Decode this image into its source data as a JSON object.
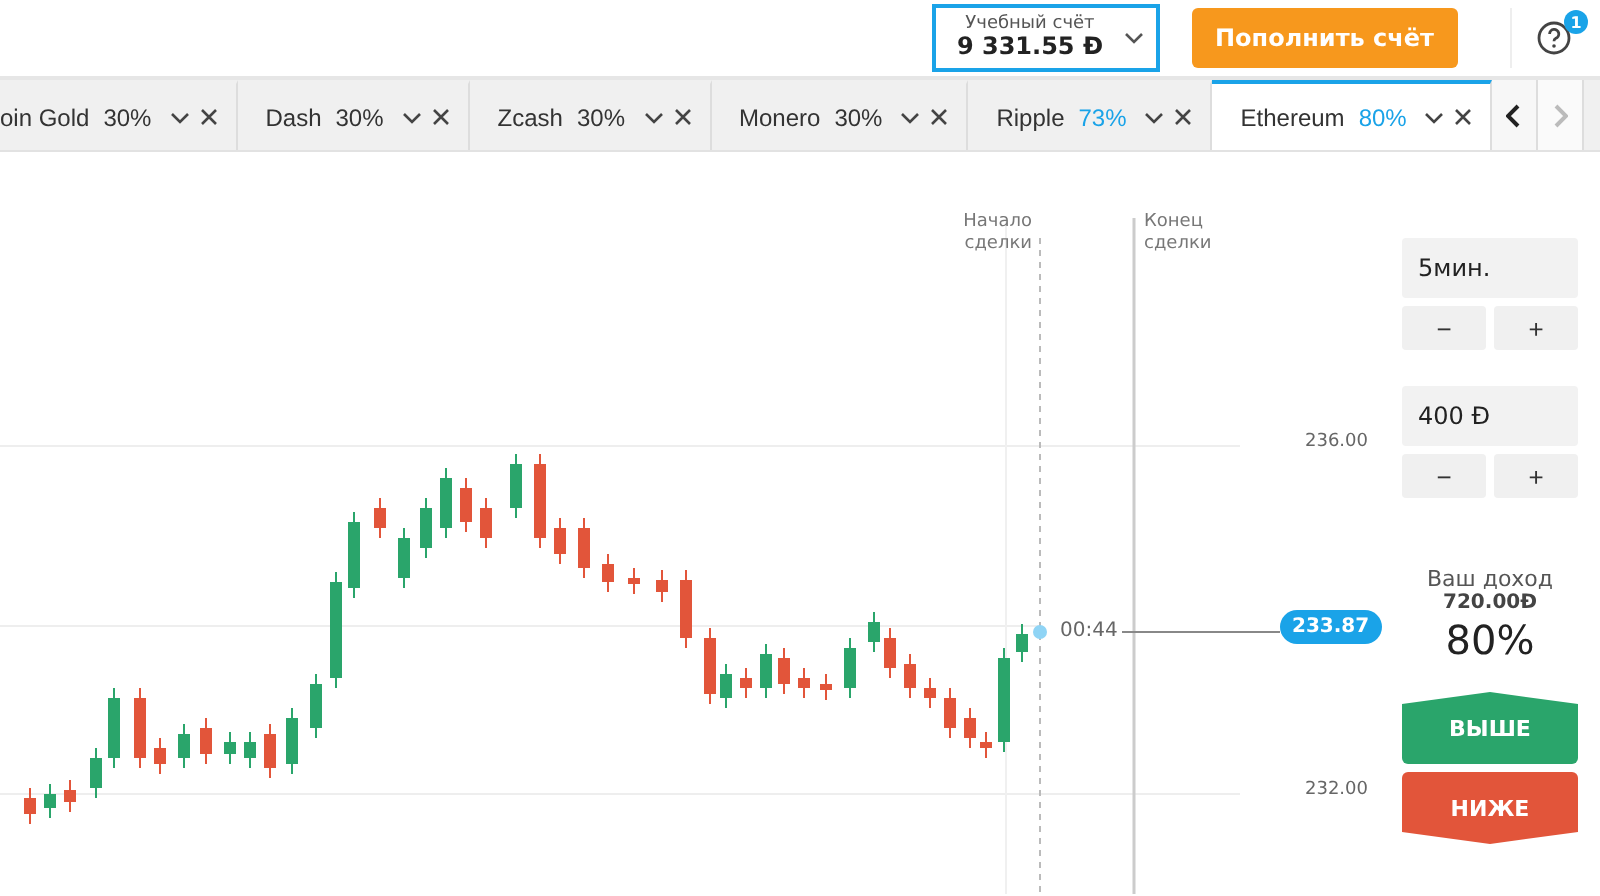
{
  "header": {
    "account": {
      "label": "Учебный счёт",
      "balance": "9 331.55 Ð"
    },
    "deposit_button": "Пополнить счёт",
    "help_badge": "1"
  },
  "tabs": [
    {
      "label": "oin Gold",
      "percent": "30%",
      "highlight": false,
      "selected": false
    },
    {
      "label": "Dash",
      "percent": "30%",
      "highlight": false,
      "selected": false
    },
    {
      "label": "Zcash",
      "percent": "30%",
      "highlight": false,
      "selected": false
    },
    {
      "label": "Monero",
      "percent": "30%",
      "highlight": false,
      "selected": false
    },
    {
      "label": "Ripple",
      "percent": "73%",
      "highlight": true,
      "selected": false
    },
    {
      "label": "Ethereum",
      "percent": "80%",
      "highlight": true,
      "selected": true
    }
  ],
  "tab_nav": [
    {
      "kind": "prev",
      "disabled": false
    },
    {
      "kind": "next",
      "disabled": true
    }
  ],
  "chart": {
    "y_labels": [
      "236.00",
      "232.00"
    ],
    "start_label": "Начало сделки",
    "end_label": "Конец сделки",
    "timer": "00:44",
    "price": "233.87"
  },
  "panel": {
    "fields": [
      {
        "value": "5мин.",
        "minus": "−",
        "plus": "+"
      },
      {
        "value": "400 Ð",
        "minus": "−",
        "plus": "+"
      }
    ],
    "income_label": "Ваш доход",
    "income_value": "720.00Ð",
    "payout": "80%",
    "buttons": [
      {
        "label": "ВЫШЕ",
        "kind": "up"
      },
      {
        "label": "НИЖЕ",
        "kind": "down"
      }
    ]
  }
}
